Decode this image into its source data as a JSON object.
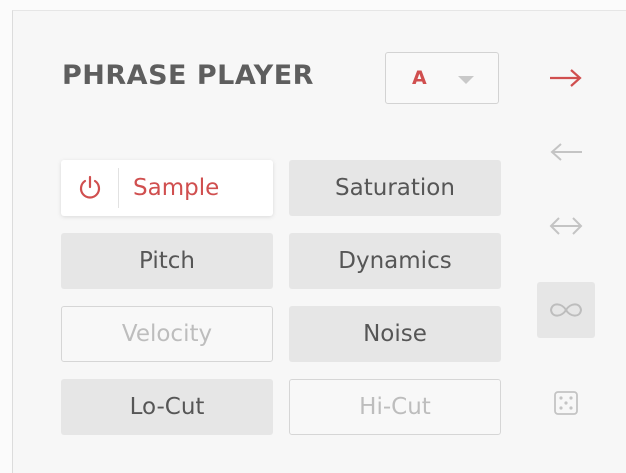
{
  "header": {
    "title": "PHRASE PLAYER",
    "preset": {
      "value": "A"
    }
  },
  "modules": {
    "sample": {
      "label": "Sample",
      "state": "on"
    },
    "saturation": {
      "label": "Saturation",
      "state": "on"
    },
    "pitch": {
      "label": "Pitch",
      "state": "on"
    },
    "dynamics": {
      "label": "Dynamics",
      "state": "on"
    },
    "velocity": {
      "label": "Velocity",
      "state": "off"
    },
    "noise": {
      "label": "Noise",
      "state": "on"
    },
    "locut": {
      "label": "Lo-Cut",
      "state": "on"
    },
    "hicut": {
      "label": "Hi-Cut",
      "state": "off"
    }
  },
  "playback_modes": {
    "selected": "forward",
    "items": [
      {
        "id": "forward",
        "icon": "arrow-right-icon"
      },
      {
        "id": "reverse",
        "icon": "arrow-left-icon"
      },
      {
        "id": "ping-pong",
        "icon": "arrow-left-right-icon"
      },
      {
        "id": "loop",
        "icon": "infinity-icon"
      },
      {
        "id": "random",
        "icon": "dice-icon"
      }
    ]
  },
  "colors": {
    "accent": "#d04f4f",
    "button_fill": "#e6e6e6",
    "text": "#565656",
    "disabled_text": "#bdbdbd"
  }
}
